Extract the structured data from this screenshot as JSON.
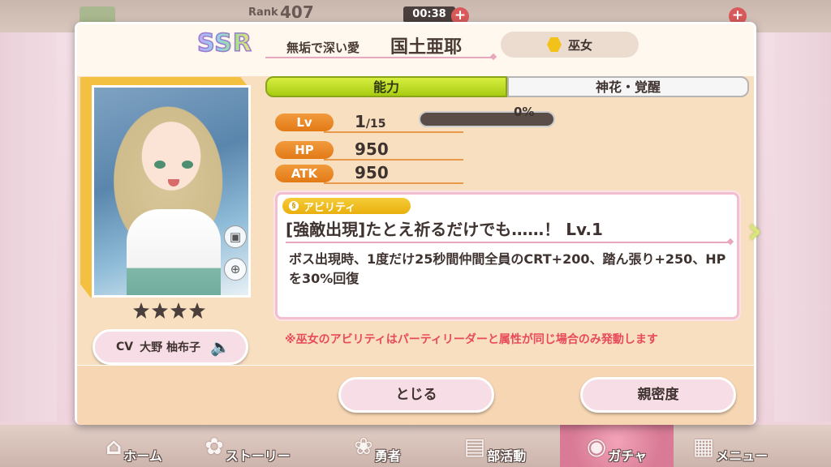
{
  "hud": {
    "rank_label": "Rank",
    "rank_value": "407",
    "timer": "00:38",
    "plus": "+"
  },
  "nav": {
    "items": [
      {
        "label": "ホーム",
        "icon": "home-icon"
      },
      {
        "label": "ストーリー",
        "icon": "story-icon"
      },
      {
        "label": "勇者",
        "icon": "hero-icon"
      },
      {
        "label": "部活動",
        "icon": "club-icon"
      },
      {
        "label": "ガチャ",
        "icon": "gacha-icon"
      },
      {
        "label": "メニュー",
        "icon": "menu-icon"
      }
    ]
  },
  "card": {
    "rarity": "SSR",
    "subtitle": "無垢で深い愛",
    "name": "国土亜耶",
    "attribute": "巫女",
    "attribute_color": "#f2c21a",
    "cv_label": "CV",
    "cv_name": "大野 柚布子",
    "stars": 4
  },
  "tabs": {
    "ability": "能力",
    "awakening": "神花・覚醒"
  },
  "stats": {
    "lv_label": "Lv",
    "lv_value": "1",
    "lv_max": "/15",
    "exp_percent": "0%",
    "hp_label": "HP",
    "hp_value": "950",
    "atk_label": "ATK",
    "atk_value": "950"
  },
  "ability": {
    "tag": "アビリティ",
    "title": "[強敵出現]たとえ祈るだけでも……！ Lv.1",
    "description": "ボス出現時、1度だけ25秒間仲間全員のCRT+200、踏ん張り+250、HPを30%回復"
  },
  "note": "※巫女のアビリティはパーティリーダーと属性が同じ場合のみ発動します",
  "buttons": {
    "close": "とじる",
    "affinity": "親密度"
  }
}
